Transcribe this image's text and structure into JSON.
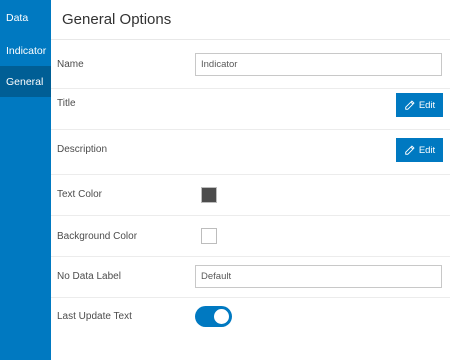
{
  "sidebar": {
    "tabs": [
      {
        "label": "Data"
      },
      {
        "label": "Indicator"
      },
      {
        "label": "General"
      }
    ]
  },
  "panel": {
    "title": "General Options",
    "name": {
      "label": "Name",
      "value": "Indicator"
    },
    "title_row": {
      "label": "Title",
      "button_label": "Edit"
    },
    "description": {
      "label": "Description",
      "button_label": "Edit"
    },
    "text_color": {
      "label": "Text Color",
      "value": "#4c4c4c"
    },
    "background_color": {
      "label": "Background Color",
      "value": "#ffffff"
    },
    "no_data_label": {
      "label": "No Data Label",
      "placeholder": "Default"
    },
    "last_update_text": {
      "label": "Last Update Text",
      "enabled": true
    }
  },
  "colors": {
    "accent": "#0079c1",
    "active_tab": "#005e95"
  }
}
